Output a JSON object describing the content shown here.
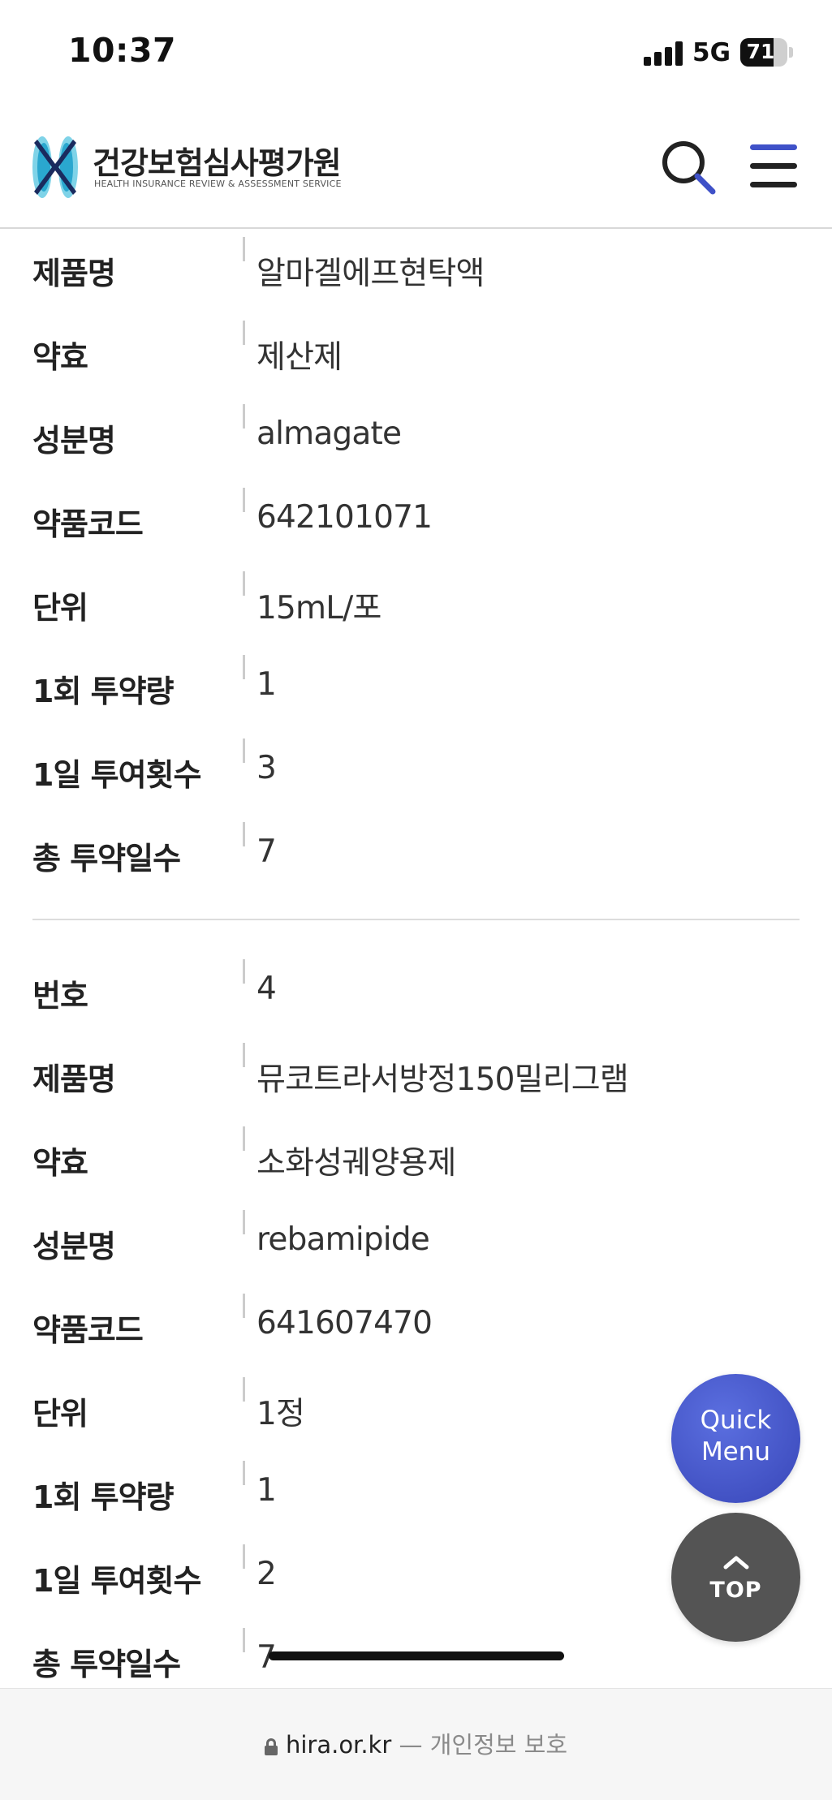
{
  "status_bar": {
    "time": "10:37",
    "network": "5G",
    "battery": "71",
    "battery_level": 0.71,
    "signal_bars": 4
  },
  "header": {
    "logo_korean": "건강보험심사평가원",
    "logo_english": "HEALTH INSURANCE REVIEW & ASSESSMENT SERVICE",
    "search_icon": "search-icon",
    "menu_icon": "hamburger-menu-icon",
    "accent_color": "#3f51c8"
  },
  "drugs": [
    {
      "rows": [
        {
          "label": "제품명",
          "value": "알마겔에프현탁액"
        },
        {
          "label": "약효",
          "value": "제산제"
        },
        {
          "label": "성분명",
          "value": "almagate"
        },
        {
          "label": "약품코드",
          "value": "642101071"
        },
        {
          "label": "단위",
          "value": "15mL/포"
        },
        {
          "label": "1회 투약량",
          "value": "1"
        },
        {
          "label": "1일 투여횟수",
          "value": "3"
        },
        {
          "label": "총 투약일수",
          "value": "7"
        }
      ]
    },
    {
      "rows": [
        {
          "label": "번호",
          "value": "4"
        },
        {
          "label": "제품명",
          "value": "뮤코트라서방정150밀리그램"
        },
        {
          "label": "약효",
          "value": "소화성궤양용제"
        },
        {
          "label": "성분명",
          "value": "rebamipide"
        },
        {
          "label": "약품코드",
          "value": "641607470"
        },
        {
          "label": "단위",
          "value": "1정"
        },
        {
          "label": "1회 투약량",
          "value": "1"
        },
        {
          "label": "1일 투여횟수",
          "value": "2"
        },
        {
          "label": "총 투약일수",
          "value": "7"
        }
      ]
    }
  ],
  "floating": {
    "quick_menu_line1": "Quick",
    "quick_menu_line2": "Menu",
    "top_label": "TOP"
  },
  "browser": {
    "domain": "hira.or.kr",
    "privacy": "— 개인정보 보호"
  }
}
